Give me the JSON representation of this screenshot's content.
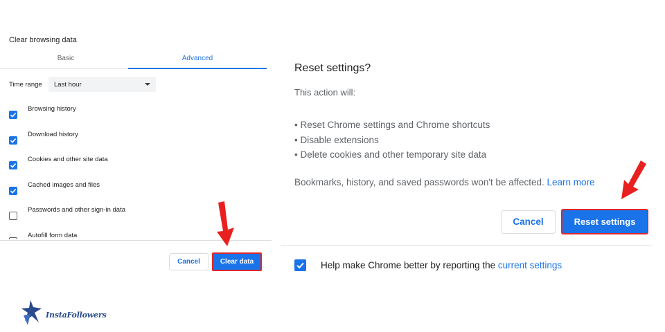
{
  "left_dialog": {
    "title": "Clear browsing data",
    "tabs": [
      {
        "label": "Basic",
        "selected": false
      },
      {
        "label": "Advanced",
        "selected": true
      }
    ],
    "time_range": {
      "label": "Time range",
      "value": "Last hour"
    },
    "items": [
      {
        "label": "Browsing history",
        "checked": true
      },
      {
        "label": "Download history",
        "checked": true
      },
      {
        "label": "Cookies and other site data",
        "checked": true
      },
      {
        "label": "Cached images and files",
        "checked": true
      },
      {
        "label": "Passwords and other sign-in data",
        "checked": false
      },
      {
        "label": "Autofill form data",
        "checked": false
      }
    ],
    "cancel_label": "Cancel",
    "clear_label": "Clear data"
  },
  "right_dialog": {
    "title": "Reset settings?",
    "subtitle": "This action will:",
    "bullets": [
      "• Reset Chrome settings and Chrome shortcuts",
      "• Disable extensions",
      "• Delete cookies and other temporary site data"
    ],
    "note": "Bookmarks, history, and saved passwords won't be affected.",
    "learn_more": "Learn more",
    "cancel_label": "Cancel",
    "reset_label": "Reset settings",
    "report_label": "Help make Chrome better by reporting the",
    "report_link": "current settings",
    "report_checked": true
  },
  "logo": {
    "text": "InstaFollowers"
  },
  "colors": {
    "accent": "#1a73e8",
    "highlight": "#e0262a",
    "arrow": "#e8201f"
  }
}
